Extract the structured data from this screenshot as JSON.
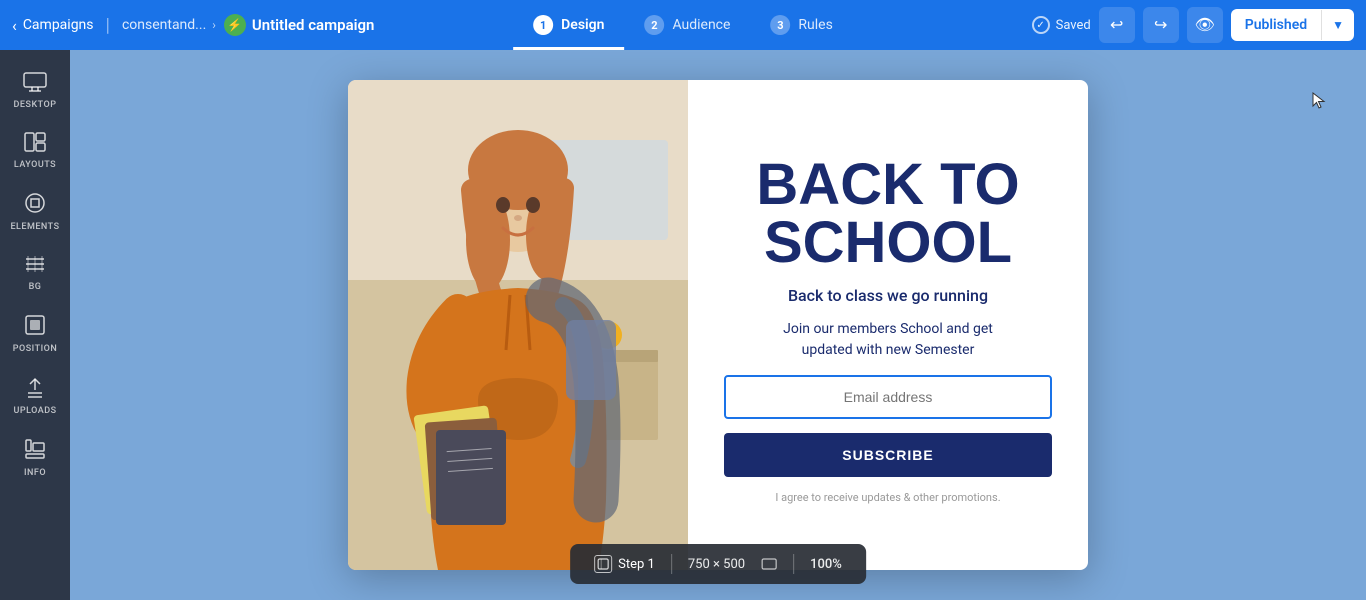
{
  "nav": {
    "campaigns_label": "Campaigns",
    "breadcrumb_label": "consentand...",
    "campaign_title": "Untitled campaign",
    "campaign_icon": "⚡",
    "tabs": [
      {
        "number": "1",
        "label": "Design",
        "active": true
      },
      {
        "number": "2",
        "label": "Audience",
        "active": false
      },
      {
        "number": "3",
        "label": "Rules",
        "active": false
      }
    ],
    "saved_label": "Saved",
    "undo_label": "↩",
    "redo_label": "↪",
    "preview_label": "👁",
    "published_label": "Published",
    "dropdown_icon": "▾"
  },
  "sidebar": {
    "items": [
      {
        "id": "desktop",
        "icon": "🖥",
        "label": "DESKTOP"
      },
      {
        "id": "layouts",
        "icon": "⊞",
        "label": "LAYOUTS"
      },
      {
        "id": "elements",
        "icon": "◇",
        "label": "ELEMENTS"
      },
      {
        "id": "bg",
        "icon": "▤",
        "label": "BG"
      },
      {
        "id": "position",
        "icon": "⬛",
        "label": "POSITION"
      },
      {
        "id": "uploads",
        "icon": "⬆",
        "label": "UPLOADS"
      },
      {
        "id": "info",
        "icon": "⌨",
        "label": "INFO"
      }
    ]
  },
  "popup": {
    "title_line1": "BACK TO",
    "title_line2": "SCHOOL",
    "subtitle1": "Back to class we go running",
    "subtitle2": "Join our members School and get\nupdated with new Semester",
    "email_placeholder": "Email address",
    "subscribe_label": "SUBSCRIBE",
    "agree_text": "I agree to receive updates & other promotions."
  },
  "bottom_bar": {
    "step_label": "Step 1",
    "dimensions": "750 × 500",
    "zoom": "100%"
  }
}
